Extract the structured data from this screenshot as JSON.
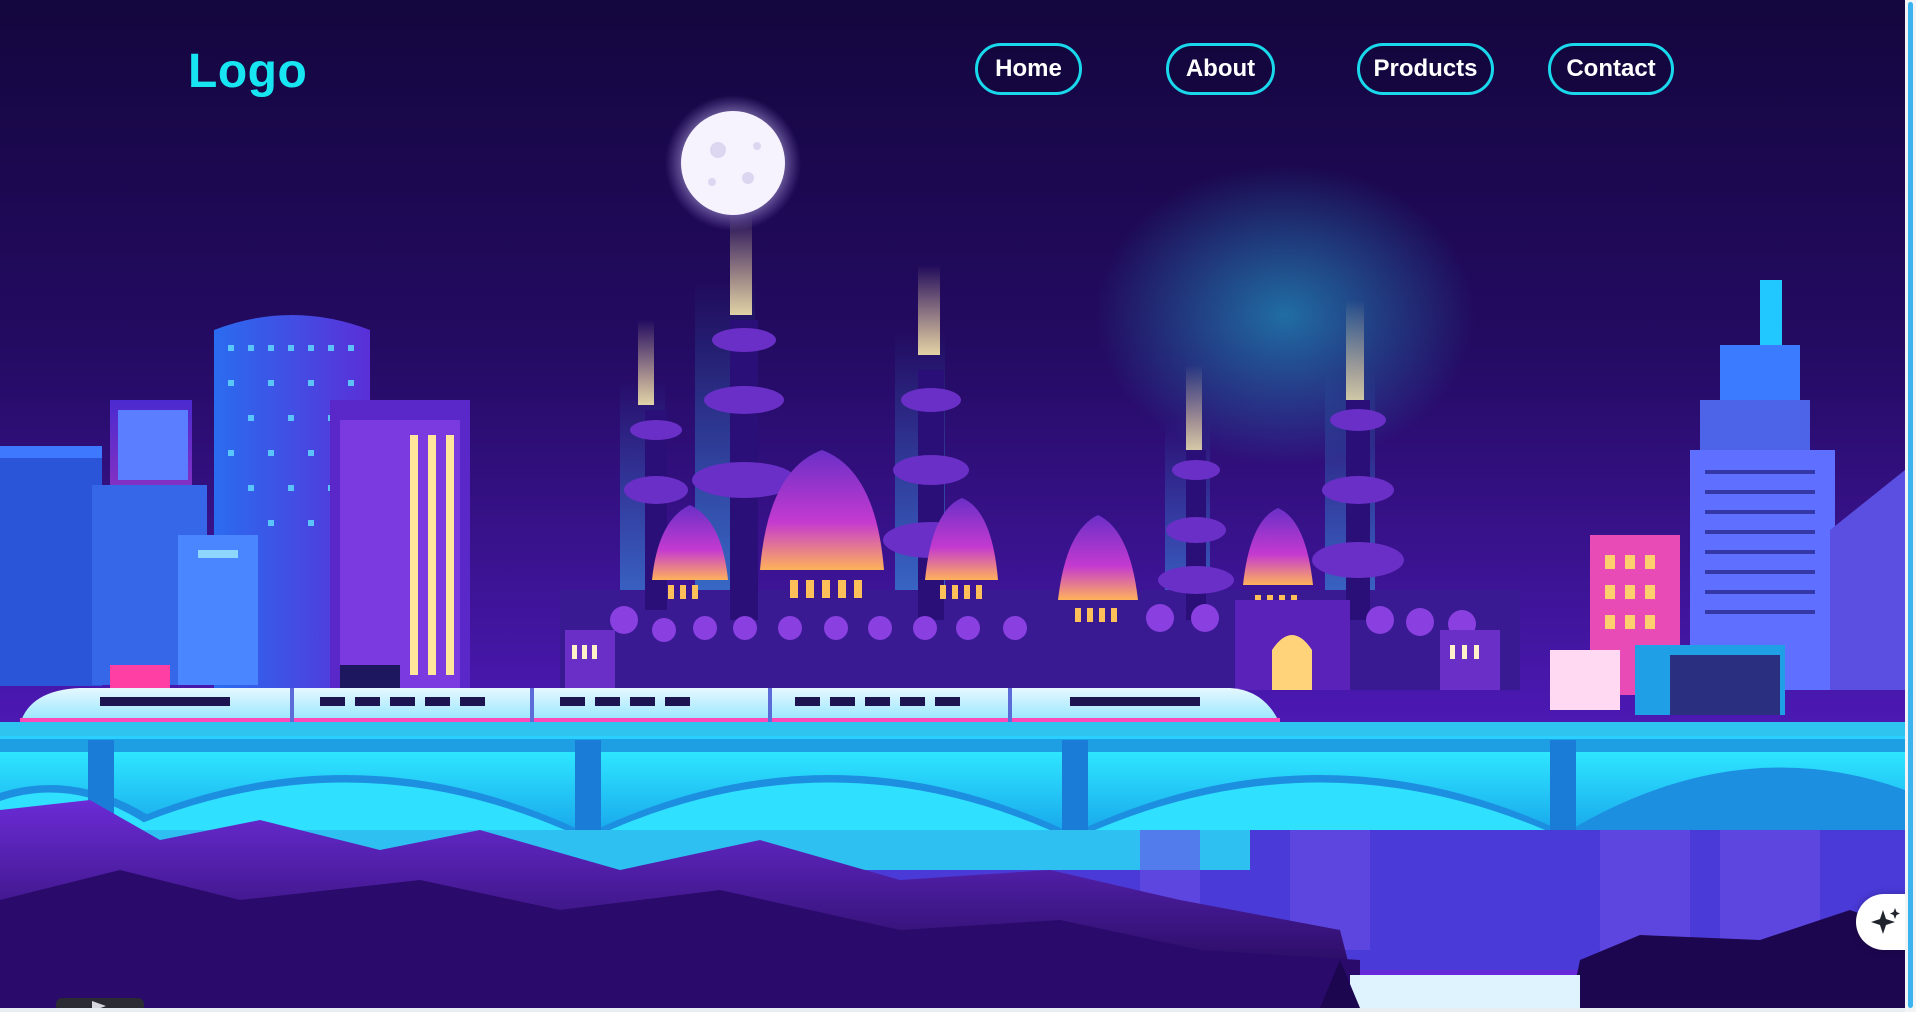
{
  "header": {
    "logo_text": "Logo",
    "nav_items": [
      {
        "label": "Home"
      },
      {
        "label": "About"
      },
      {
        "label": "Products"
      },
      {
        "label": "Contact"
      }
    ]
  },
  "floating_action": {
    "icon": "sparkle-icon"
  },
  "colors": {
    "accent": "#17e6f2",
    "sky_top": "#14063e",
    "sky_bottom": "#5a1fc4",
    "water": "#18c8ee"
  }
}
